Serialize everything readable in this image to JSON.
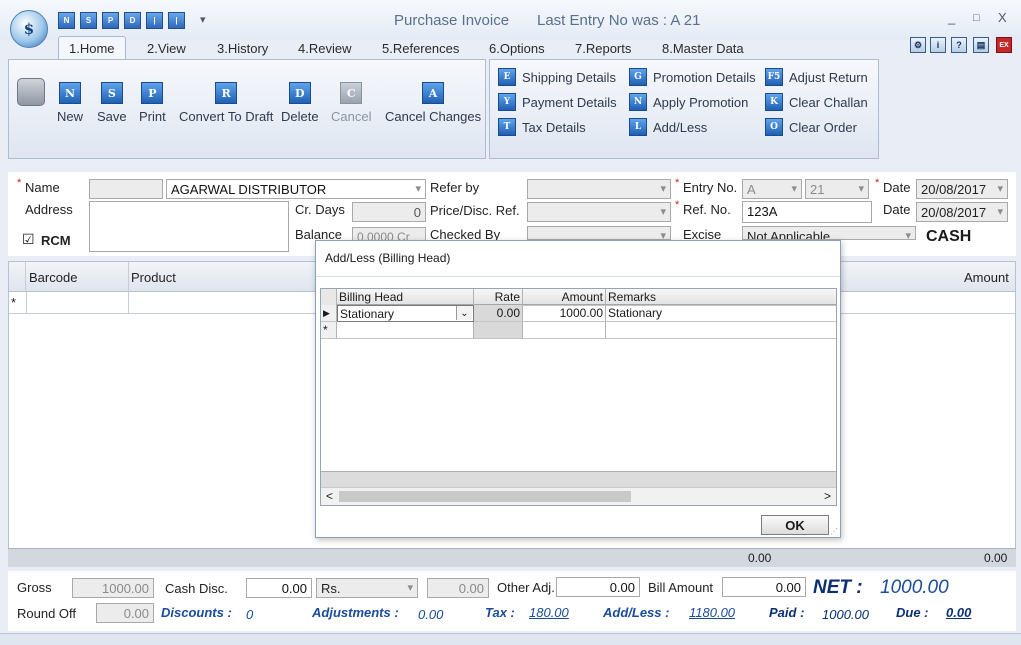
{
  "window": {
    "title": "Purchase Invoice",
    "last_entry": "Last Entry No was : A 21",
    "minimize": "_",
    "maximize": "□",
    "close": "X"
  },
  "logo_text": "$",
  "quick_access": [
    "N",
    "S",
    "P",
    "D",
    "|",
    "|"
  ],
  "quick_access_more": "▾",
  "tabs": [
    "1.Home",
    "2.View",
    "3.History",
    "4.Review",
    "5.References",
    "6.Options",
    "7.Reports",
    "8.Master Data"
  ],
  "ribbon": {
    "new": {
      "icon": "N",
      "label": "New"
    },
    "save": {
      "icon": "S",
      "label": "Save"
    },
    "print": {
      "icon": "P",
      "label": "Print"
    },
    "convert": {
      "icon": "R",
      "label": "Convert To Draft"
    },
    "delete": {
      "icon": "D",
      "label": "Delete"
    },
    "cancel": {
      "icon": "C",
      "label": "Cancel"
    },
    "cancel_changes": {
      "icon": "A",
      "label": "Cancel Changes"
    },
    "shipping": {
      "icon": "E",
      "label": "Shipping Details"
    },
    "payment": {
      "icon": "Y",
      "label": "Payment Details"
    },
    "tax": {
      "icon": "T",
      "label": "Tax Details"
    },
    "promotion": {
      "icon": "G",
      "label": "Promotion Details"
    },
    "apply_promotion": {
      "icon": "N",
      "label": "Apply Promotion"
    },
    "addless": {
      "icon": "L",
      "label": "Add/Less"
    },
    "adjust_return": {
      "icon": "F5",
      "label": "Adjust Return"
    },
    "clear_challan": {
      "icon": "K",
      "label": "Clear Challan"
    },
    "clear_order": {
      "icon": "O",
      "label": "Clear Order"
    }
  },
  "form": {
    "name_label": "Name",
    "name_value": "AGARWAL DISTRIBUTOR",
    "address_label": "Address",
    "rcm_label": "RCM",
    "rcm_check": "☑",
    "cr_days_label": "Cr. Days",
    "cr_days_value": "0",
    "balance_label": "Balance",
    "balance_value": "0.0000 Cr",
    "refer_by_label": "Refer by",
    "price_disc_label": "Price/Disc. Ref.",
    "checked_by_label": "Checked By",
    "entry_no_label": "Entry No.",
    "entry_series": "A",
    "entry_no": "21",
    "ref_no_label": "Ref. No.",
    "ref_no_value": "123A",
    "excise_label": "Excise",
    "excise_value": "Not Applicable",
    "date_label": "Date",
    "date_value": "20/08/2017",
    "date2_label": "Date",
    "date2_value": "20/08/2017",
    "payment_mode": "CASH"
  },
  "grid": {
    "col_barcode": "Barcode",
    "col_product": "Product",
    "col_amount": "Amount",
    "new_row_marker": "*",
    "total_1": "0.00",
    "total_2": "0.00"
  },
  "dialog": {
    "title": "Add/Less (Billing Head)",
    "columns": [
      "Billing Head",
      "Rate",
      "Amount",
      "Remarks"
    ],
    "rows": [
      {
        "billing_head": "Stationary",
        "rate": "0.00",
        "amount": "1000.00",
        "remarks": "Stationary"
      }
    ],
    "current_marker": "▶",
    "new_row_marker": "*",
    "ok_label": "OK",
    "scroll_left": "<",
    "scroll_right": ">"
  },
  "footer": {
    "gross_label": "Gross",
    "gross_value": "1000.00",
    "cash_disc_label": "Cash Disc.",
    "cash_disc_value": "0.00",
    "cash_disc_unit": "Rs.",
    "cash_disc_calc": "0.00",
    "other_adj_label": "Other Adj.",
    "other_adj_value": "0.00",
    "bill_amount_label": "Bill Amount",
    "bill_amount_value": "0.00",
    "net_label": "NET :",
    "net_value": "1000.00",
    "round_off_label": "Round Off",
    "round_off_value": "0.00",
    "discounts_label": "Discounts :",
    "discounts_value": "0",
    "adjustments_label": "Adjustments :",
    "adjustments_value": "0.00",
    "tax_label": "Tax :",
    "tax_value": "180.00",
    "addless_label": "Add/Less :",
    "addless_value": "1180.00",
    "paid_label": "Paid :",
    "paid_value": "1000.00",
    "due_label": "Due :",
    "due_value": "0.00"
  }
}
